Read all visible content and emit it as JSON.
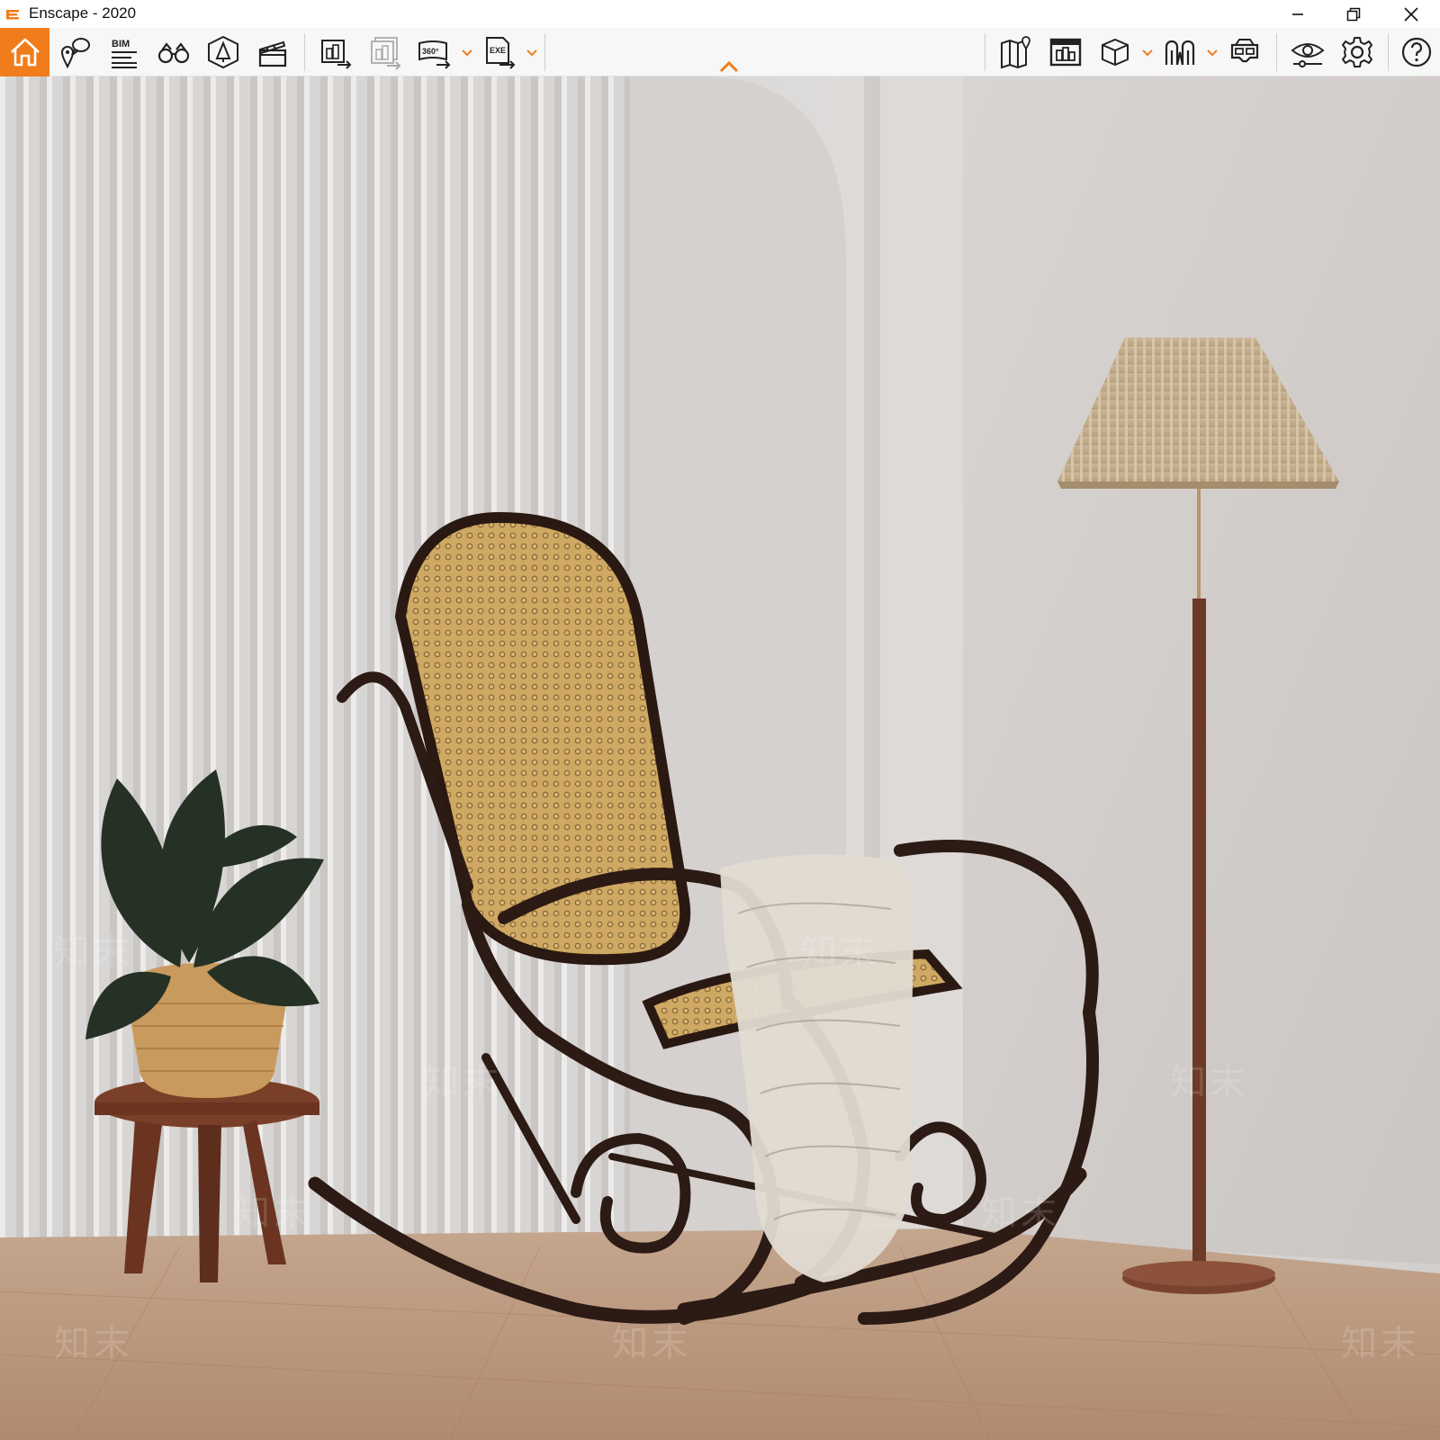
{
  "window": {
    "title": "Enscape - 2020",
    "accent_color": "#f07d1c",
    "controls": [
      "minimize-icon",
      "restore-icon",
      "close-icon"
    ]
  },
  "toolbar": {
    "left_buttons": [
      {
        "icon": "home-icon",
        "active": true
      },
      {
        "icon": "location-pin-icon"
      },
      {
        "icon": "bim-icon",
        "label": "BIM"
      },
      {
        "icon": "binoculars-icon"
      },
      {
        "icon": "atmosphere-icon"
      },
      {
        "icon": "clapperboard-icon"
      },
      {
        "icon": "screenshot-export-icon"
      },
      {
        "icon": "batch-export-icon"
      },
      {
        "icon": "panorama-icon",
        "label": "360°"
      },
      {
        "icon": "standalone-export-icon",
        "label": "EXE"
      }
    ],
    "right_buttons": [
      {
        "icon": "map-icon"
      },
      {
        "icon": "asset-library-icon"
      },
      {
        "icon": "cube-view-icon"
      },
      {
        "icon": "navigation-icon"
      },
      {
        "icon": "vr-headset-icon"
      },
      {
        "icon": "visual-settings-icon"
      },
      {
        "icon": "settings-gear-icon"
      },
      {
        "icon": "help-icon"
      }
    ]
  },
  "viewport": {
    "watermark_text": "知末"
  }
}
